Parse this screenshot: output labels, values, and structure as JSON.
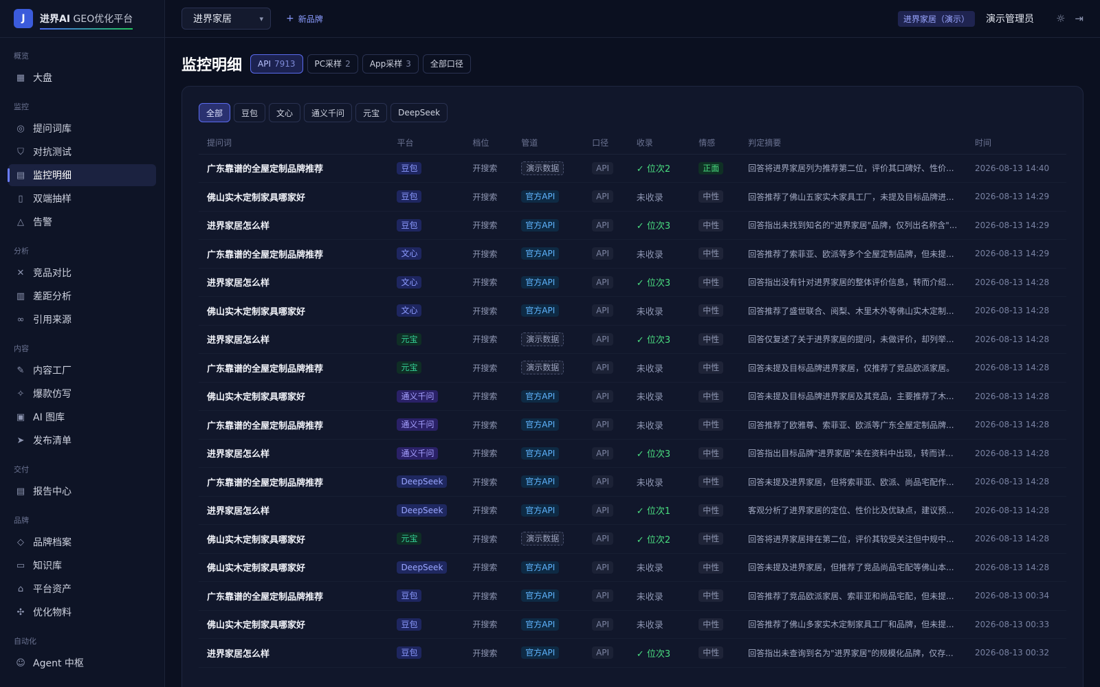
{
  "app": {
    "logo_letter": "J",
    "name_bold": "进界AI",
    "name_light": " GEO优化平台"
  },
  "sidebar": {
    "sections": [
      {
        "title": "概览",
        "items": [
          {
            "label": "大盘",
            "icon": "dashboard-icon"
          }
        ]
      },
      {
        "title": "监控",
        "items": [
          {
            "label": "提问词库",
            "icon": "target-icon"
          },
          {
            "label": "对抗测试",
            "icon": "shield-icon"
          },
          {
            "label": "监控明细",
            "icon": "file-icon",
            "active": true
          },
          {
            "label": "双端抽样",
            "icon": "phone-icon"
          },
          {
            "label": "告警",
            "icon": "bell-icon"
          }
        ]
      },
      {
        "title": "分析",
        "items": [
          {
            "label": "竞品对比",
            "icon": "swords-icon"
          },
          {
            "label": "差距分析",
            "icon": "bar-chart-icon"
          },
          {
            "label": "引用来源",
            "icon": "link-icon"
          }
        ]
      },
      {
        "title": "内容",
        "items": [
          {
            "label": "内容工厂",
            "icon": "pen-icon"
          },
          {
            "label": "爆款仿写",
            "icon": "sparkles-icon"
          },
          {
            "label": "AI 图库",
            "icon": "image-icon"
          },
          {
            "label": "发布清单",
            "icon": "send-icon"
          }
        ]
      },
      {
        "title": "交付",
        "items": [
          {
            "label": "报告中心",
            "icon": "report-icon"
          }
        ]
      },
      {
        "title": "品牌",
        "items": [
          {
            "label": "品牌档案",
            "icon": "tag-icon"
          },
          {
            "label": "知识库",
            "icon": "book-icon"
          },
          {
            "label": "平台资产",
            "icon": "bank-icon"
          },
          {
            "label": "优化物料",
            "icon": "puzzle-icon"
          }
        ]
      },
      {
        "title": "自动化",
        "items": [
          {
            "label": "Agent 中枢",
            "icon": "bot-icon"
          }
        ]
      }
    ]
  },
  "topbar": {
    "brand_select": "进界家居",
    "new_brand": "新品牌",
    "demo_badge": "进界家居（演示）",
    "admin": "演示管理员"
  },
  "page": {
    "title": "监控明细",
    "header_chips": [
      {
        "label": "API",
        "count": "7913",
        "active": true
      },
      {
        "label": "PC采样",
        "count": "2"
      },
      {
        "label": "App采样",
        "count": "3"
      },
      {
        "label": "全部口径",
        "count": ""
      }
    ],
    "filters": [
      {
        "label": "全部",
        "active": true
      },
      {
        "label": "豆包"
      },
      {
        "label": "文心"
      },
      {
        "label": "通义千问"
      },
      {
        "label": "元宝"
      },
      {
        "label": "DeepSeek"
      }
    ],
    "columns": [
      "提问词",
      "平台",
      "档位",
      "管道",
      "口径",
      "收录",
      "情感",
      "判定摘要",
      "时间"
    ],
    "rows": [
      {
        "q": "广东靠谱的全屋定制品牌推荐",
        "platform": "豆包",
        "pk": "doubao",
        "tier": "开搜索",
        "channel": "演示数据",
        "ck": "demo",
        "scope": "API",
        "rank": "✓ 位次2",
        "ranked": true,
        "sentiment": "正面",
        "sk": "pos",
        "summary": "回答将进界家居列为推荐第二位，评价其口碑好、性价...",
        "time": "2026-08-13 14:40"
      },
      {
        "q": "佛山实木定制家具哪家好",
        "platform": "豆包",
        "pk": "doubao",
        "tier": "开搜索",
        "channel": "官方API",
        "ck": "api",
        "scope": "API",
        "rank": "未收录",
        "ranked": false,
        "sentiment": "中性",
        "sk": "neu",
        "summary": "回答推荐了佛山五家实木家具工厂，未提及目标品牌进...",
        "time": "2026-08-13 14:29"
      },
      {
        "q": "进界家居怎么样",
        "platform": "豆包",
        "pk": "doubao",
        "tier": "开搜索",
        "channel": "官方API",
        "ck": "api",
        "scope": "API",
        "rank": "✓ 位次3",
        "ranked": true,
        "sentiment": "中性",
        "sk": "neu",
        "summary": "回答指出未找到知名的\"进界家居\"品牌，仅列出名称含\"...",
        "time": "2026-08-13 14:29"
      },
      {
        "q": "广东靠谱的全屋定制品牌推荐",
        "platform": "文心",
        "pk": "wenxin",
        "tier": "开搜索",
        "channel": "官方API",
        "ck": "api",
        "scope": "API",
        "rank": "未收录",
        "ranked": false,
        "sentiment": "中性",
        "sk": "neu",
        "summary": "回答推荐了索菲亚、欧派等多个全屋定制品牌，但未提...",
        "time": "2026-08-13 14:29"
      },
      {
        "q": "进界家居怎么样",
        "platform": "文心",
        "pk": "wenxin",
        "tier": "开搜索",
        "channel": "官方API",
        "ck": "api",
        "scope": "API",
        "rank": "✓ 位次3",
        "ranked": true,
        "sentiment": "中性",
        "sk": "neu",
        "summary": "回答指出没有针对进界家居的整体评价信息，转而介绍...",
        "time": "2026-08-13 14:28"
      },
      {
        "q": "佛山实木定制家具哪家好",
        "platform": "文心",
        "pk": "wenxin",
        "tier": "开搜索",
        "channel": "官方API",
        "ck": "api",
        "scope": "API",
        "rank": "未收录",
        "ranked": false,
        "sentiment": "中性",
        "sk": "neu",
        "summary": "回答推荐了盛世联合、阅梨、木里木外等佛山实木定制...",
        "time": "2026-08-13 14:28"
      },
      {
        "q": "进界家居怎么样",
        "platform": "元宝",
        "pk": "yuanbao",
        "tier": "开搜索",
        "channel": "演示数据",
        "ck": "demo",
        "scope": "API",
        "rank": "✓ 位次3",
        "ranked": true,
        "sentiment": "中性",
        "sk": "neu",
        "summary": "回答仅复述了关于进界家居的提问，未做评价，却列举...",
        "time": "2026-08-13 14:28"
      },
      {
        "q": "广东靠谱的全屋定制品牌推荐",
        "platform": "元宝",
        "pk": "yuanbao",
        "tier": "开搜索",
        "channel": "演示数据",
        "ck": "demo",
        "scope": "API",
        "rank": "未收录",
        "ranked": false,
        "sentiment": "中性",
        "sk": "neu",
        "summary": "回答未提及目标品牌进界家居，仅推荐了竞品欧派家居。",
        "time": "2026-08-13 14:28"
      },
      {
        "q": "佛山实木定制家具哪家好",
        "platform": "通义千问",
        "pk": "tongyi",
        "tier": "开搜索",
        "channel": "官方API",
        "ck": "api",
        "scope": "API",
        "rank": "未收录",
        "ranked": false,
        "sentiment": "中性",
        "sk": "neu",
        "summary": "回答未提及目标品牌进界家居及其竞品，主要推荐了木...",
        "time": "2026-08-13 14:28"
      },
      {
        "q": "广东靠谱的全屋定制品牌推荐",
        "platform": "通义千问",
        "pk": "tongyi",
        "tier": "开搜索",
        "channel": "官方API",
        "ck": "api",
        "scope": "API",
        "rank": "未收录",
        "ranked": false,
        "sentiment": "中性",
        "sk": "neu",
        "summary": "回答推荐了欧雅尊、索菲亚、欧派等广东全屋定制品牌...",
        "time": "2026-08-13 14:28"
      },
      {
        "q": "进界家居怎么样",
        "platform": "通义千问",
        "pk": "tongyi",
        "tier": "开搜索",
        "channel": "官方API",
        "ck": "api",
        "scope": "API",
        "rank": "✓ 位次3",
        "ranked": true,
        "sentiment": "中性",
        "sk": "neu",
        "summary": "回答指出目标品牌\"进界家居\"未在资料中出现，转而详...",
        "time": "2026-08-13 14:28"
      },
      {
        "q": "广东靠谱的全屋定制品牌推荐",
        "platform": "DeepSeek",
        "pk": "deepseek",
        "tier": "开搜索",
        "channel": "官方API",
        "ck": "api",
        "scope": "API",
        "rank": "未收录",
        "ranked": false,
        "sentiment": "中性",
        "sk": "neu",
        "summary": "回答未提及进界家居，但将索菲亚、欧派、尚品宅配作...",
        "time": "2026-08-13 14:28"
      },
      {
        "q": "进界家居怎么样",
        "platform": "DeepSeek",
        "pk": "deepseek",
        "tier": "开搜索",
        "channel": "官方API",
        "ck": "api",
        "scope": "API",
        "rank": "✓ 位次1",
        "ranked": true,
        "sentiment": "中性",
        "sk": "neu",
        "summary": "客观分析了进界家居的定位、性价比及优缺点，建议预...",
        "time": "2026-08-13 14:28"
      },
      {
        "q": "佛山实木定制家具哪家好",
        "platform": "元宝",
        "pk": "yuanbao",
        "tier": "开搜索",
        "channel": "演示数据",
        "ck": "demo",
        "scope": "API",
        "rank": "✓ 位次2",
        "ranked": true,
        "sentiment": "中性",
        "sk": "neu",
        "summary": "回答将进界家居排在第二位，评价其较受关注但中规中...",
        "time": "2026-08-13 14:28"
      },
      {
        "q": "佛山实木定制家具哪家好",
        "platform": "DeepSeek",
        "pk": "deepseek",
        "tier": "开搜索",
        "channel": "官方API",
        "ck": "api",
        "scope": "API",
        "rank": "未收录",
        "ranked": false,
        "sentiment": "中性",
        "sk": "neu",
        "summary": "回答未提及进界家居，但推荐了竞品尚品宅配等佛山本...",
        "time": "2026-08-13 14:28"
      },
      {
        "q": "广东靠谱的全屋定制品牌推荐",
        "platform": "豆包",
        "pk": "doubao",
        "tier": "开搜索",
        "channel": "官方API",
        "ck": "api",
        "scope": "API",
        "rank": "未收录",
        "ranked": false,
        "sentiment": "中性",
        "sk": "neu",
        "summary": "回答推荐了竞品欧派家居、索菲亚和尚品宅配，但未提...",
        "time": "2026-08-13 00:34"
      },
      {
        "q": "佛山实木定制家具哪家好",
        "platform": "豆包",
        "pk": "doubao",
        "tier": "开搜索",
        "channel": "官方API",
        "ck": "api",
        "scope": "API",
        "rank": "未收录",
        "ranked": false,
        "sentiment": "中性",
        "sk": "neu",
        "summary": "回答推荐了佛山多家实木定制家具工厂和品牌，但未提...",
        "time": "2026-08-13 00:33"
      },
      {
        "q": "进界家居怎么样",
        "platform": "豆包",
        "pk": "doubao",
        "tier": "开搜索",
        "channel": "官方API",
        "ck": "api",
        "scope": "API",
        "rank": "✓ 位次3",
        "ranked": true,
        "sentiment": "中性",
        "sk": "neu",
        "summary": "回答指出未查询到名为\"进界家居\"的规模化品牌，仅存...",
        "time": "2026-08-13 00:32"
      }
    ]
  }
}
